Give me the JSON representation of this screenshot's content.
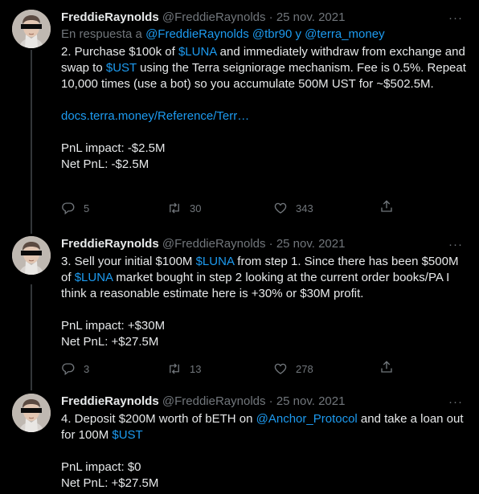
{
  "tweets": [
    {
      "name": "FreddieRaynolds",
      "handle": "@FreddieRaynolds",
      "date": "· 25 nov. 2021",
      "reply_prefix": "En respuesta a",
      "reply_user1": "@FreddieRaynolds",
      "reply_user2": "@tbr90",
      "reply_and": "y",
      "reply_user3": "@terra_money",
      "t1": "2. Purchase $100k of ",
      "t2": "$LUNA",
      "t3": " and immediately  withdraw from exchange and swap to ",
      "t4": "$UST",
      "t5": " using the Terra seigniorage mechanism. Fee is 0.5%. Repeat 10,000 times (use a bot) so you accumulate 500M UST for ~$502.5M.",
      "doc_link": "docs.terra.money/Reference/Terr…",
      "pnl_impact": "PnL impact: -$2.5M",
      "net_pnl": "Net PnL: -$2.5M",
      "replies": "5",
      "retweets": "30",
      "likes": "343"
    },
    {
      "name": "FreddieRaynolds",
      "handle": "@FreddieRaynolds",
      "date": "· 25 nov. 2021",
      "t1": "3. Sell your initial $100M ",
      "t2": "$LUNA",
      "t3": " from step 1. Since there has been $500M of ",
      "t4": "$LUNA",
      "t5": " market bought in step 2 looking at the current order books/PA I think a reasonable estimate here is +30% or $30M profit.",
      "pnl_impact": "PnL impact: +$30M",
      "net_pnl": "Net PnL: +$27.5M",
      "replies": "3",
      "retweets": "13",
      "likes": "278"
    },
    {
      "name": "FreddieRaynolds",
      "handle": "@FreddieRaynolds",
      "date": "· 25 nov. 2021",
      "t1": "4. Deposit $200M worth of bETH on ",
      "t2": "@Anchor_Protocol",
      "t3": " and take a loan out for 100M ",
      "t4": "$UST",
      "pnl_impact": "PnL impact: $0",
      "net_pnl": "Net PnL: +$27.5M"
    }
  ],
  "more_glyph": "···",
  "colors": {
    "background": "#000000",
    "text": "#e7e9ea",
    "muted": "#71767b",
    "link": "#1d9bf0",
    "divider": "#2f3336"
  },
  "icons": [
    "reply-icon",
    "retweet-icon",
    "like-icon",
    "share-icon",
    "more-icon"
  ]
}
